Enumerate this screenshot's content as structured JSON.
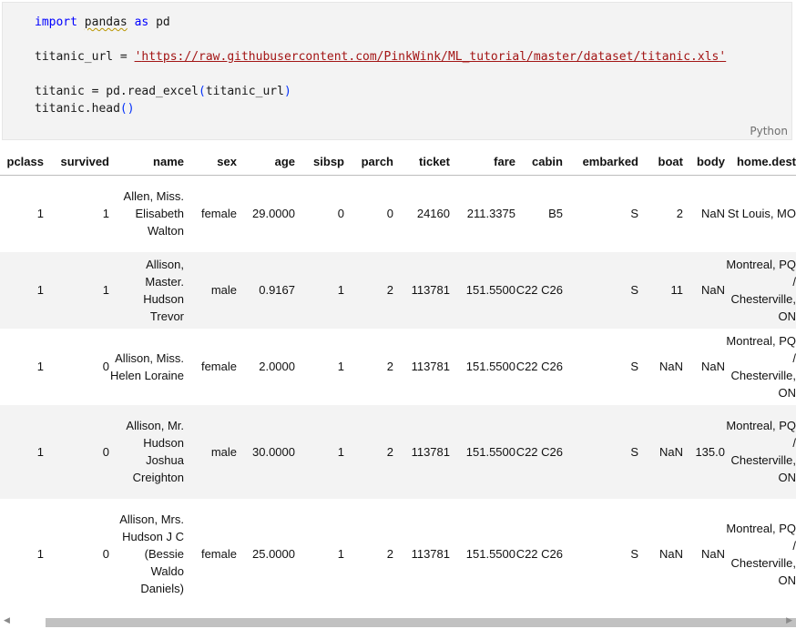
{
  "code": {
    "line1": {
      "kw1": "import",
      "mod": "pandas",
      "kw2": "as",
      "alias": "pd"
    },
    "line2": {
      "var": "titanic_url",
      "op": " = ",
      "quote_open": "'",
      "url": "https://raw.githubusercontent.com/PinkWink/ML_tutorial/master/dataset/titanic.xls",
      "quote_close": "'"
    },
    "line3": {
      "prefix": "titanic = pd.read_excel",
      "paren_open": "(",
      "arg": "titanic_url",
      "paren_close": ")"
    },
    "line4": {
      "prefix": "titanic.head",
      "parens": "()"
    }
  },
  "language_label": "Python",
  "table": {
    "columns": [
      "pclass",
      "survived",
      "name",
      "sex",
      "age",
      "sibsp",
      "parch",
      "ticket",
      "fare",
      "cabin",
      "embarked",
      "boat",
      "body",
      "home.dest"
    ],
    "rows": [
      {
        "pclass": "1",
        "survived": "1",
        "name": "Allen, Miss. Elisabeth Walton",
        "sex": "female",
        "age": "29.0000",
        "sibsp": "0",
        "parch": "0",
        "ticket": "24160",
        "fare": "211.3375",
        "cabin": "B5",
        "embarked": "S",
        "boat": "2",
        "body": "NaN",
        "home": "St Louis, MO"
      },
      {
        "pclass": "1",
        "survived": "1",
        "name": "Allison, Master. Hudson Trevor",
        "sex": "male",
        "age": "0.9167",
        "sibsp": "1",
        "parch": "2",
        "ticket": "113781",
        "fare": "151.5500",
        "cabin": "C22 C26",
        "embarked": "S",
        "boat": "11",
        "body": "NaN",
        "home": "Montreal, PQ / Chesterville, ON"
      },
      {
        "pclass": "1",
        "survived": "0",
        "name": "Allison, Miss. Helen Loraine",
        "sex": "female",
        "age": "2.0000",
        "sibsp": "1",
        "parch": "2",
        "ticket": "113781",
        "fare": "151.5500",
        "cabin": "C22 C26",
        "embarked": "S",
        "boat": "NaN",
        "body": "NaN",
        "home": "Montreal, PQ / Chesterville, ON"
      },
      {
        "pclass": "1",
        "survived": "0",
        "name": "Allison, Mr. Hudson Joshua Creighton",
        "sex": "male",
        "age": "30.0000",
        "sibsp": "1",
        "parch": "2",
        "ticket": "113781",
        "fare": "151.5500",
        "cabin": "C22 C26",
        "embarked": "S",
        "boat": "NaN",
        "body": "135.0",
        "home": "Montreal, PQ / Chesterville, ON"
      },
      {
        "pclass": "1",
        "survived": "0",
        "name": "Allison, Mrs. Hudson J C (Bessie Waldo Daniels)",
        "sex": "female",
        "age": "25.0000",
        "sibsp": "1",
        "parch": "2",
        "ticket": "113781",
        "fare": "151.5500",
        "cabin": "C22 C26",
        "embarked": "S",
        "boat": "NaN",
        "body": "NaN",
        "home": "Montreal, PQ / Chesterville, ON"
      }
    ]
  },
  "scrollbar": {
    "left_arrow_icon": "◀",
    "right_arrow_icon": "▶"
  }
}
